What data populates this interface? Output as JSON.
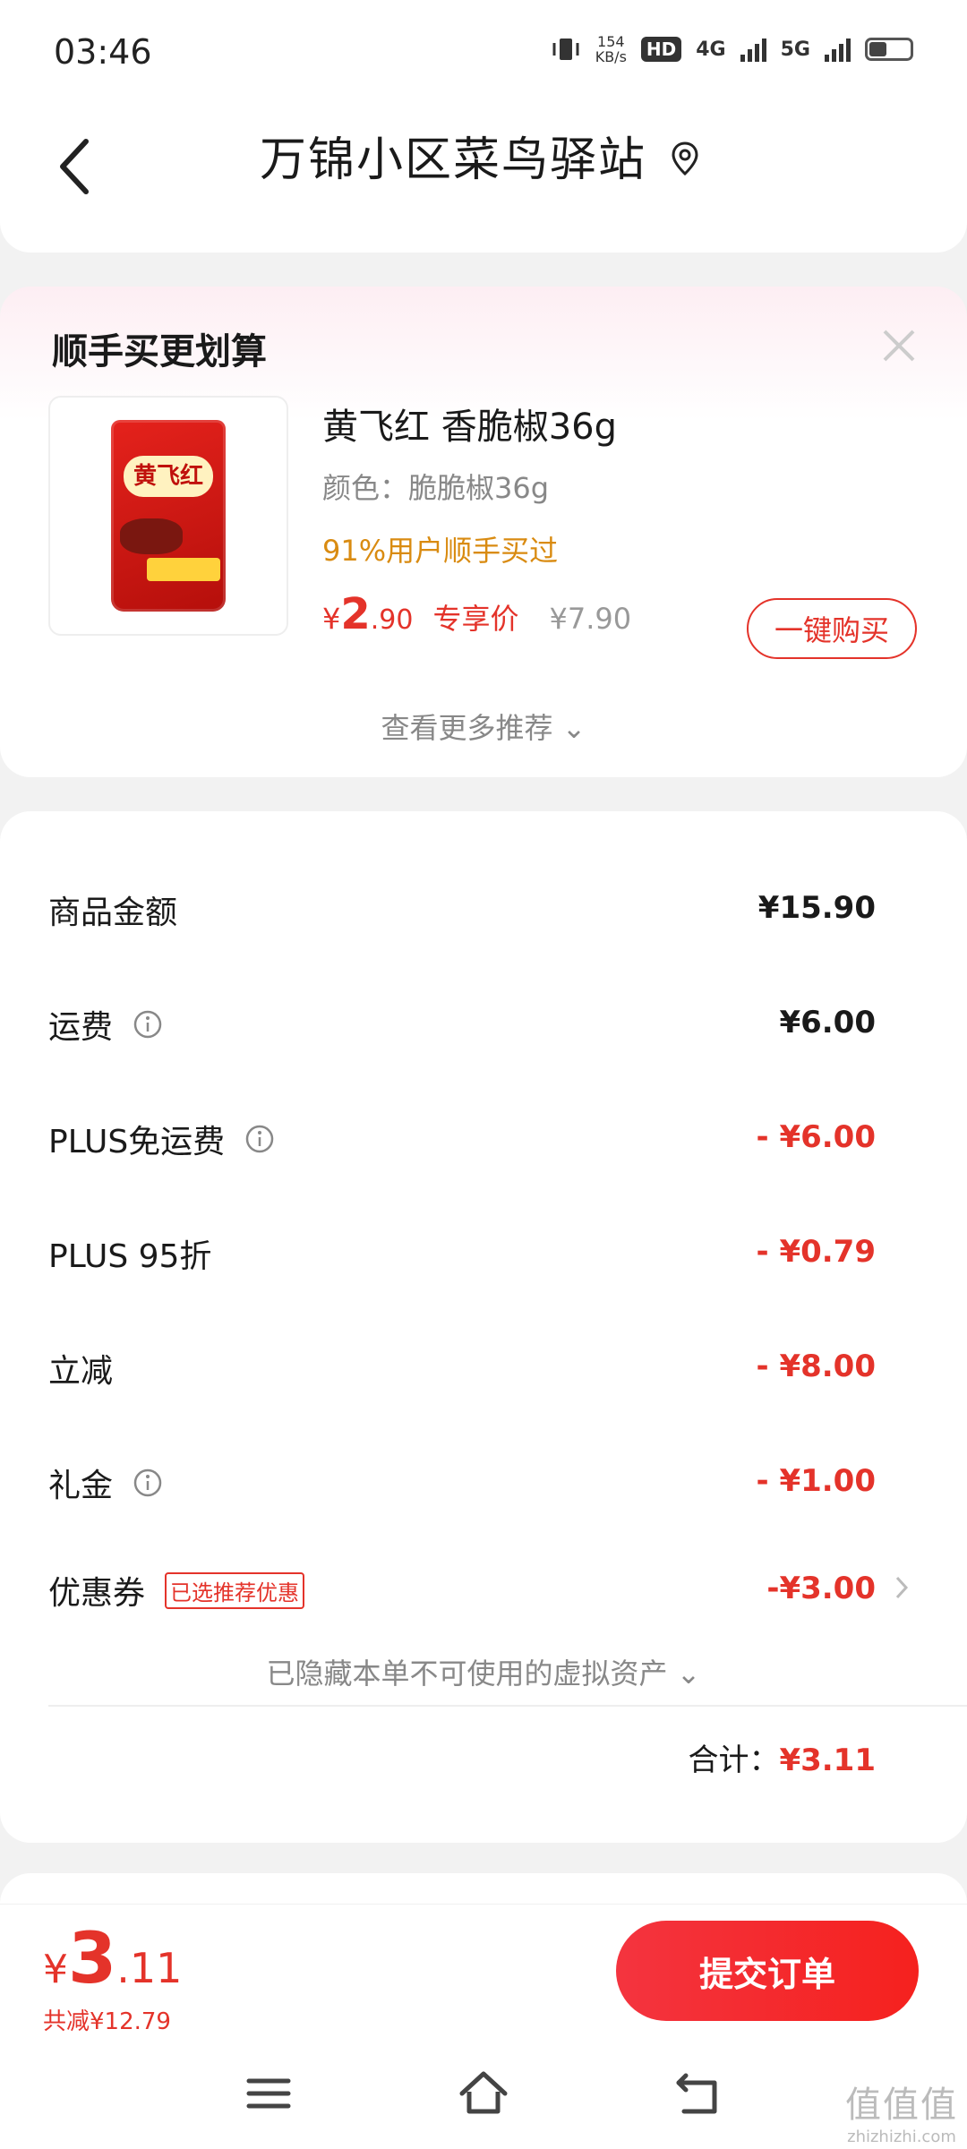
{
  "status_bar": {
    "time": "03:46",
    "net_speed_value": "154",
    "net_speed_unit": "KB/s",
    "hd_badge": "HD",
    "net_4g": "4G",
    "net_5g": "5G"
  },
  "header": {
    "title": "万锦小区菜鸟驿站"
  },
  "recommend": {
    "title": "顺手买更划算",
    "product": {
      "image_label": "黄飞红",
      "name": "黄飞红 香脆椒36g",
      "color": "颜色：脆脆椒36g",
      "popularity": "91%用户顺手买过",
      "price_symbol": "¥",
      "price_int": "2",
      "price_dec": ".90",
      "price_tag": "专享价",
      "original_price": "¥7.90",
      "buy_label": "一键购买"
    },
    "more_label": "查看更多推荐 ⌄"
  },
  "summary": {
    "rows": [
      {
        "label": "商品金额",
        "value": "¥15.90"
      },
      {
        "label": "运费",
        "value": "¥6.00"
      },
      {
        "label": "PLUS免运费",
        "value": "- ¥6.00"
      },
      {
        "label": "PLUS 95折",
        "value": "- ¥0.79"
      },
      {
        "label": "立减",
        "value": "- ¥8.00"
      },
      {
        "label": "礼金",
        "value": "- ¥1.00"
      },
      {
        "label": "优惠券",
        "value": "-¥3.00"
      }
    ],
    "coupon_tag": "已选推荐优惠",
    "hidden_note": "已隐藏本单不可使用的虚拟资产 ⌄",
    "total_label": "合计：",
    "total_value": "¥3.11"
  },
  "footer": {
    "pay_symbol": "¥",
    "pay_int": "3",
    "pay_dec": ".11",
    "saved": "共减¥12.79",
    "submit_label": "提交订单"
  },
  "watermark": {
    "main": "值值值",
    "sub": "zhizhizhi.com"
  },
  "colors": {
    "accent_red": "#e4332a",
    "highlight_orange": "#d98b11",
    "muted_gray": "#888888"
  }
}
